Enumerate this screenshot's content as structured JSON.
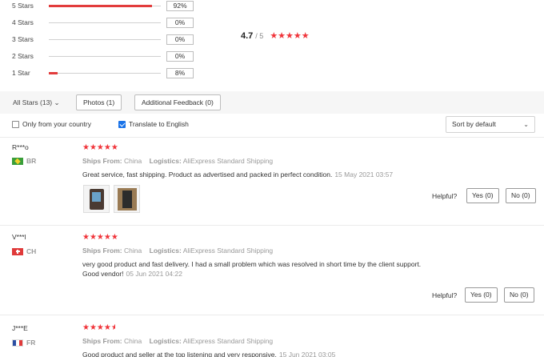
{
  "distribution": [
    {
      "label": "5 Stars",
      "percent": "92%",
      "fill": 0.92
    },
    {
      "label": "4 Stars",
      "percent": "0%",
      "fill": 0
    },
    {
      "label": "3 Stars",
      "percent": "0%",
      "fill": 0
    },
    {
      "label": "2 Stars",
      "percent": "0%",
      "fill": 0
    },
    {
      "label": "1 Star",
      "percent": "8%",
      "fill": 0.08
    }
  ],
  "summary": {
    "score": "4.7",
    "out_of": "/ 5",
    "stars": "★★★★★"
  },
  "filters": {
    "all_stars": "All Stars (13)",
    "photos": "Photos (1)",
    "additional": "Additional Feedback (0)",
    "only_country": "Only from your country",
    "translate": "Translate to English",
    "sort": "Sort by default"
  },
  "reviews": [
    {
      "name": "R***o",
      "country": "BR",
      "stars": "★★★★★",
      "ships_label": "Ships From:",
      "ships_from": "China",
      "logistics_label": "Logistics:",
      "logistics": "AliExpress Standard Shipping",
      "text1": "Great service, fast shipping. Product as advertised and packed in perfect condition.",
      "text2": "",
      "date": "15 May 2021 03:57",
      "helpful": "Helpful?",
      "yes": "Yes (0)",
      "no": "No (0)"
    },
    {
      "name": "V***l",
      "country": "CH",
      "stars": "★★★★★",
      "ships_label": "Ships From:",
      "ships_from": "China",
      "logistics_label": "Logistics:",
      "logistics": "AliExpress Standard Shipping",
      "text1": "very good product and fast delivery. I had a small problem which was resolved in short time by the client support.",
      "text2": "Good vendor!",
      "date": "05 Jun 2021 04:22",
      "helpful": "Helpful?",
      "yes": "Yes (0)",
      "no": "No (0)"
    },
    {
      "name": "J***E",
      "country": "FR",
      "stars": "★★★★★",
      "ships_label": "Ships From:",
      "ships_from": "China",
      "logistics_label": "Logistics:",
      "logistics": "AliExpress Standard Shipping",
      "text1": "Good product and seller at the top listening and very responsive.",
      "text2": "",
      "date": "15 Jun 2021 03:05"
    }
  ],
  "colors": {
    "star": "#f0343a",
    "bar": "#e23c3c",
    "check": "#1a73e8"
  }
}
